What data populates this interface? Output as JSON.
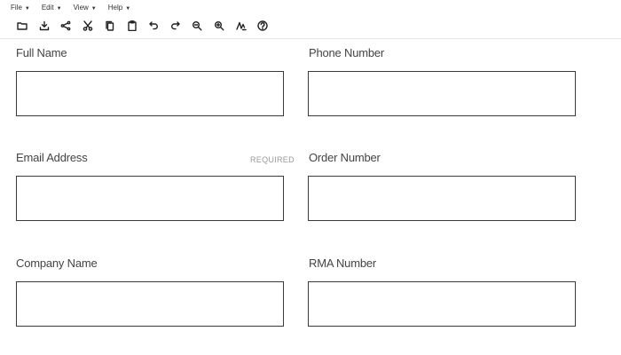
{
  "menubar": [
    {
      "label": "File"
    },
    {
      "label": "Edit"
    },
    {
      "label": "View"
    },
    {
      "label": "Help"
    }
  ],
  "toolbar_icons": [
    "folder-icon",
    "download-icon",
    "share-icon",
    "cut-icon",
    "copy-icon",
    "paste-icon",
    "undo-icon",
    "redo-icon",
    "zoom-out-icon",
    "zoom-in-icon",
    "signature-icon",
    "help-icon"
  ],
  "form": {
    "full_name": {
      "label": "Full Name",
      "value": "",
      "placeholder": ""
    },
    "phone_number": {
      "label": "Phone Number",
      "value": "",
      "placeholder": ""
    },
    "email_address": {
      "label": "Email Address",
      "required": "REQUIRED",
      "value": "",
      "placeholder": ""
    },
    "order_number": {
      "label": "Order Number",
      "value": "",
      "placeholder": ""
    },
    "company_name": {
      "label": "Company Name",
      "value": "",
      "placeholder": ""
    },
    "rma_number": {
      "label": "RMA Number",
      "value": "",
      "placeholder": ""
    }
  }
}
